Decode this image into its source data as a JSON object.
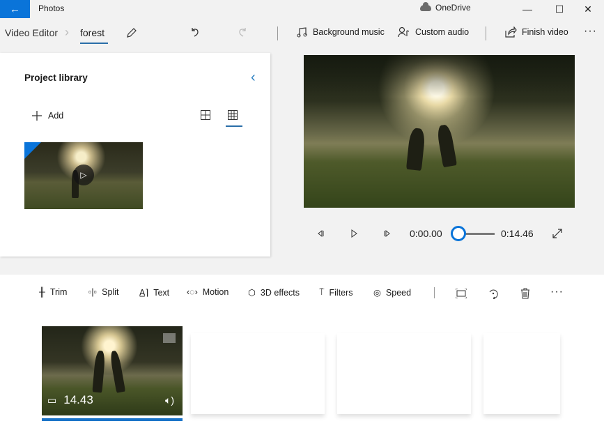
{
  "titlebar": {
    "app_title": "Photos",
    "onedrive_label": "OneDrive",
    "back_icon": "←",
    "minimize": "—",
    "maximize": "☐",
    "close": "✕"
  },
  "breadcrumb": {
    "root": "Video Editor",
    "separator": "›",
    "project": "forest"
  },
  "commandbar": {
    "background_music": "Background music",
    "custom_audio": "Custom audio",
    "finish_video": "Finish video",
    "more": "···"
  },
  "library": {
    "title": "Project library",
    "add_label": "Add",
    "collapse_icon": "‹",
    "items": [
      {
        "type": "video",
        "selected": true
      }
    ]
  },
  "player": {
    "current_time": "0:00.00",
    "total_time": "0:14.46",
    "progress": 0
  },
  "storyboard": {
    "tools": [
      {
        "label": "Trim",
        "icon": "trim-icon"
      },
      {
        "label": "Split",
        "icon": "split-icon"
      },
      {
        "label": "Text",
        "icon": "text-icon"
      },
      {
        "label": "Motion",
        "icon": "motion-icon"
      },
      {
        "label": "3D effects",
        "icon": "3d-effects-icon"
      },
      {
        "label": "Filters",
        "icon": "filters-icon"
      },
      {
        "label": "Speed",
        "icon": "speed-icon"
      }
    ],
    "more": "···",
    "clips": [
      {
        "duration": "14.43",
        "audio": true
      }
    ]
  }
}
